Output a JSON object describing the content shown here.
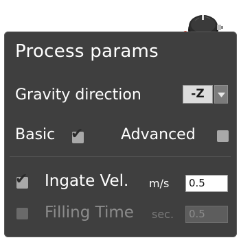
{
  "panel": {
    "title": "Process params"
  },
  "gravity": {
    "label": "Gravity direction",
    "selected": "-Z"
  },
  "mode": {
    "basic_label": "Basic",
    "basic_checked": true,
    "advanced_label": "Advanced",
    "advanced_checked": false
  },
  "ingate": {
    "label": "Ingate Vel.",
    "unit": "m/s",
    "value": "0.5",
    "checked": true
  },
  "filling": {
    "label": "Filling Time",
    "unit": "sec.",
    "value": "0.5",
    "checked": false,
    "disabled": true
  },
  "colors": {
    "panel_bg": "#3f3f3f",
    "knob_ring": "#e8321e",
    "text": "#ffffff",
    "disabled_text": "#8c8c8c"
  },
  "icons": {
    "knob": "rotary-knob-icon",
    "dropdown": "chevron-down-icon",
    "check": "checkmark-icon"
  }
}
